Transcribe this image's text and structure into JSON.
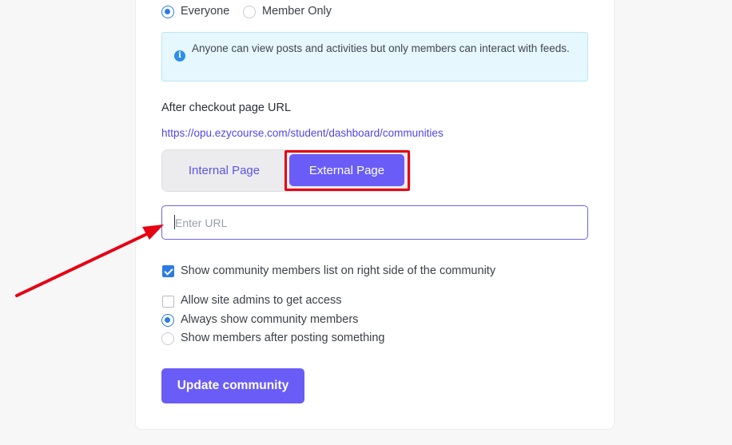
{
  "visibility": {
    "options": [
      {
        "label": "Everyone",
        "checked": true
      },
      {
        "label": "Member Only",
        "checked": false
      }
    ],
    "info_text": "Anyone can view posts and activities but only members can interact with feeds."
  },
  "checkout": {
    "title": "After checkout page URL",
    "url": "https://opu.ezycourse.com/student/dashboard/communities",
    "tabs": {
      "internal": "Internal Page",
      "external": "External Page",
      "active": "external"
    },
    "url_input": {
      "placeholder": "Enter URL",
      "value": ""
    }
  },
  "settings": {
    "show_members_list": {
      "label": "Show community members list on right side of the community",
      "checked": true
    },
    "allow_admins": {
      "label": "Allow site admins to get access",
      "checked": false
    },
    "member_display": [
      {
        "label": "Always show community members",
        "checked": true
      },
      {
        "label": "Show members after posting something",
        "checked": false
      }
    ]
  },
  "actions": {
    "update_label": "Update community"
  },
  "colors": {
    "accent": "#6a5cf6",
    "annotation": "#e60012",
    "check": "#2c7be5",
    "info_bg": "#e6f7fd"
  }
}
